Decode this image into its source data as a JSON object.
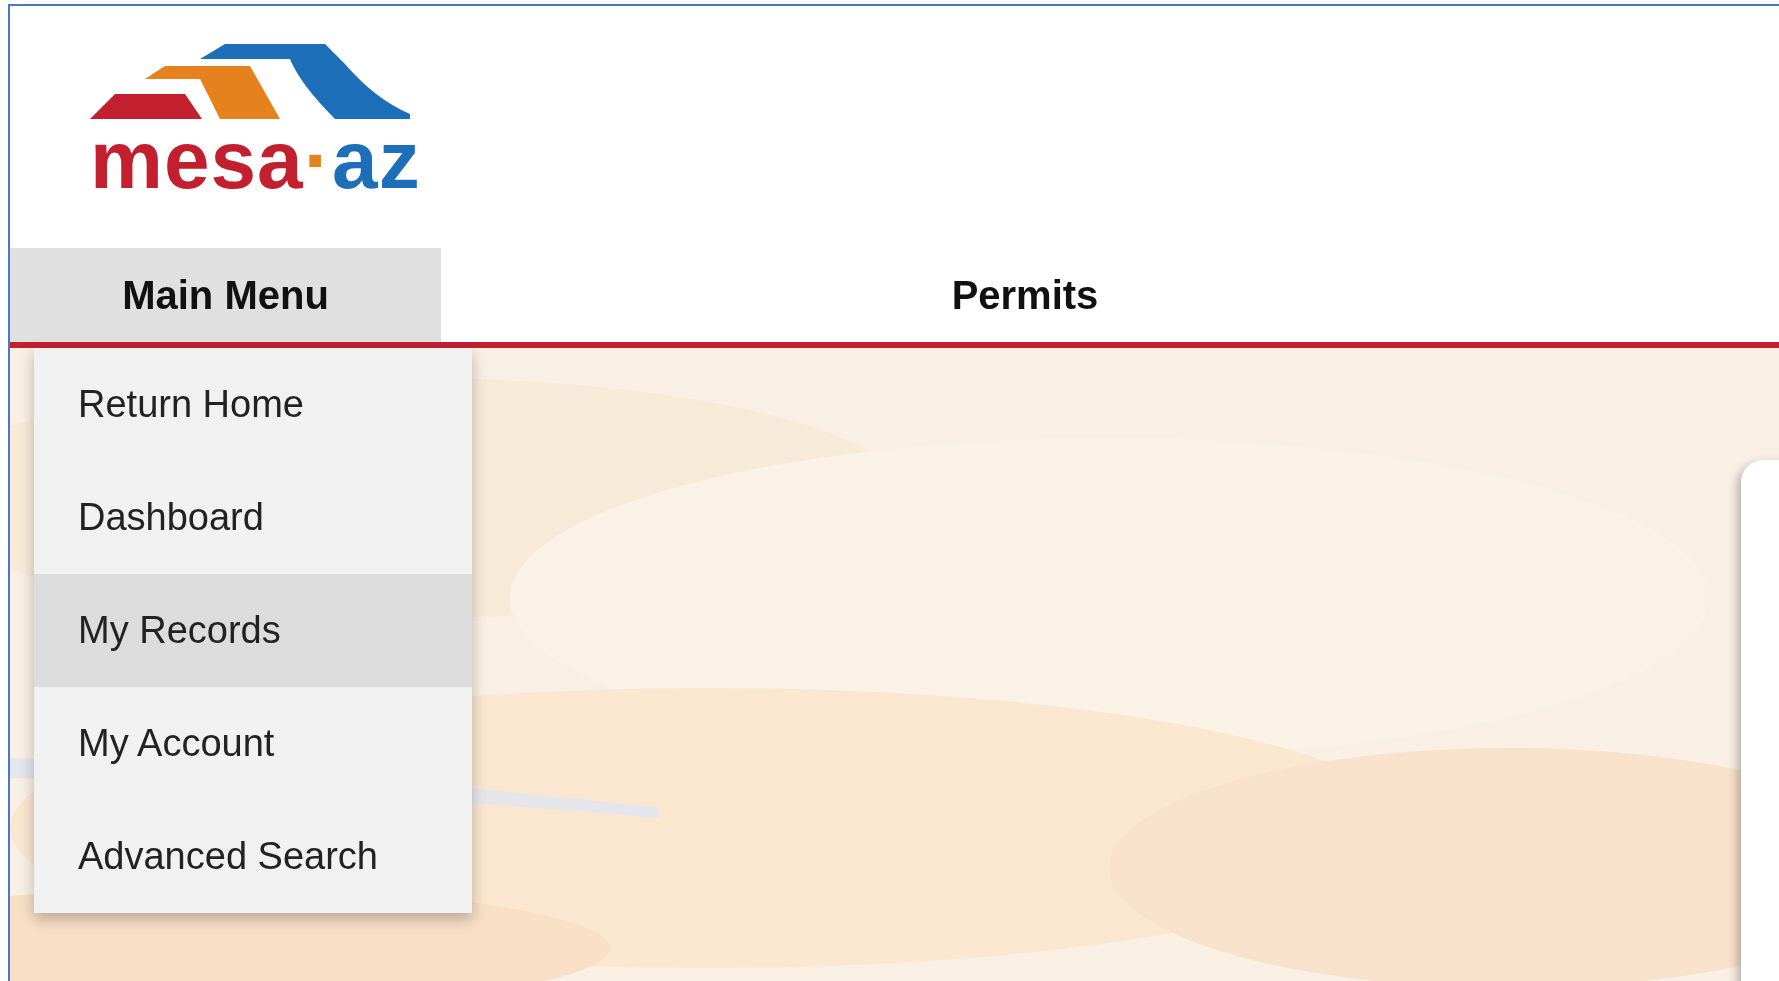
{
  "logo": {
    "word": "mesa",
    "dot": "·",
    "suffix": "az"
  },
  "nav": {
    "menu_button": {
      "label": "Main Menu",
      "expanded": true
    },
    "title": "Permits"
  },
  "menu_items": [
    {
      "label": "Return Home",
      "selected": false
    },
    {
      "label": "Dashboard",
      "selected": false
    },
    {
      "label": "My Records",
      "selected": true
    },
    {
      "label": "My Account",
      "selected": false
    },
    {
      "label": "Advanced Search",
      "selected": false
    }
  ]
}
